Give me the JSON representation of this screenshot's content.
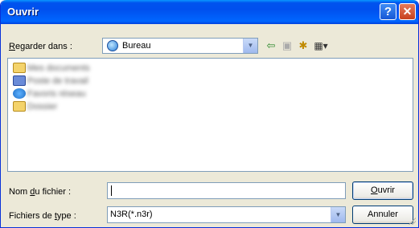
{
  "window": {
    "title": "Ouvrir"
  },
  "toolbar": {
    "lookin_label_prefix": "",
    "lookin_label_accel": "R",
    "lookin_label_rest": "egarder dans :",
    "lookin_value": "Bureau",
    "icons": [
      "back-arrow-icon",
      "up-folder-icon",
      "new-folder-icon",
      "view-menu-icon"
    ]
  },
  "filelist": {
    "items": [
      {
        "icon": "folder-icon",
        "label": "Mes documents"
      },
      {
        "icon": "computer-icon",
        "label": "Poste de travail"
      },
      {
        "icon": "network-icon",
        "label": "Favoris réseau"
      },
      {
        "icon": "folder-icon",
        "label": "Dossier"
      }
    ]
  },
  "filename": {
    "label_prefix": "Nom ",
    "label_accel": "d",
    "label_rest": "u fichier :",
    "value": ""
  },
  "filetype": {
    "label_prefix": "Fichiers de ",
    "label_accel": "t",
    "label_rest": "ype :",
    "value": "N3R(*.n3r)"
  },
  "buttons": {
    "open_accel": "O",
    "open_rest": "uvrir",
    "cancel": "Annuler"
  }
}
